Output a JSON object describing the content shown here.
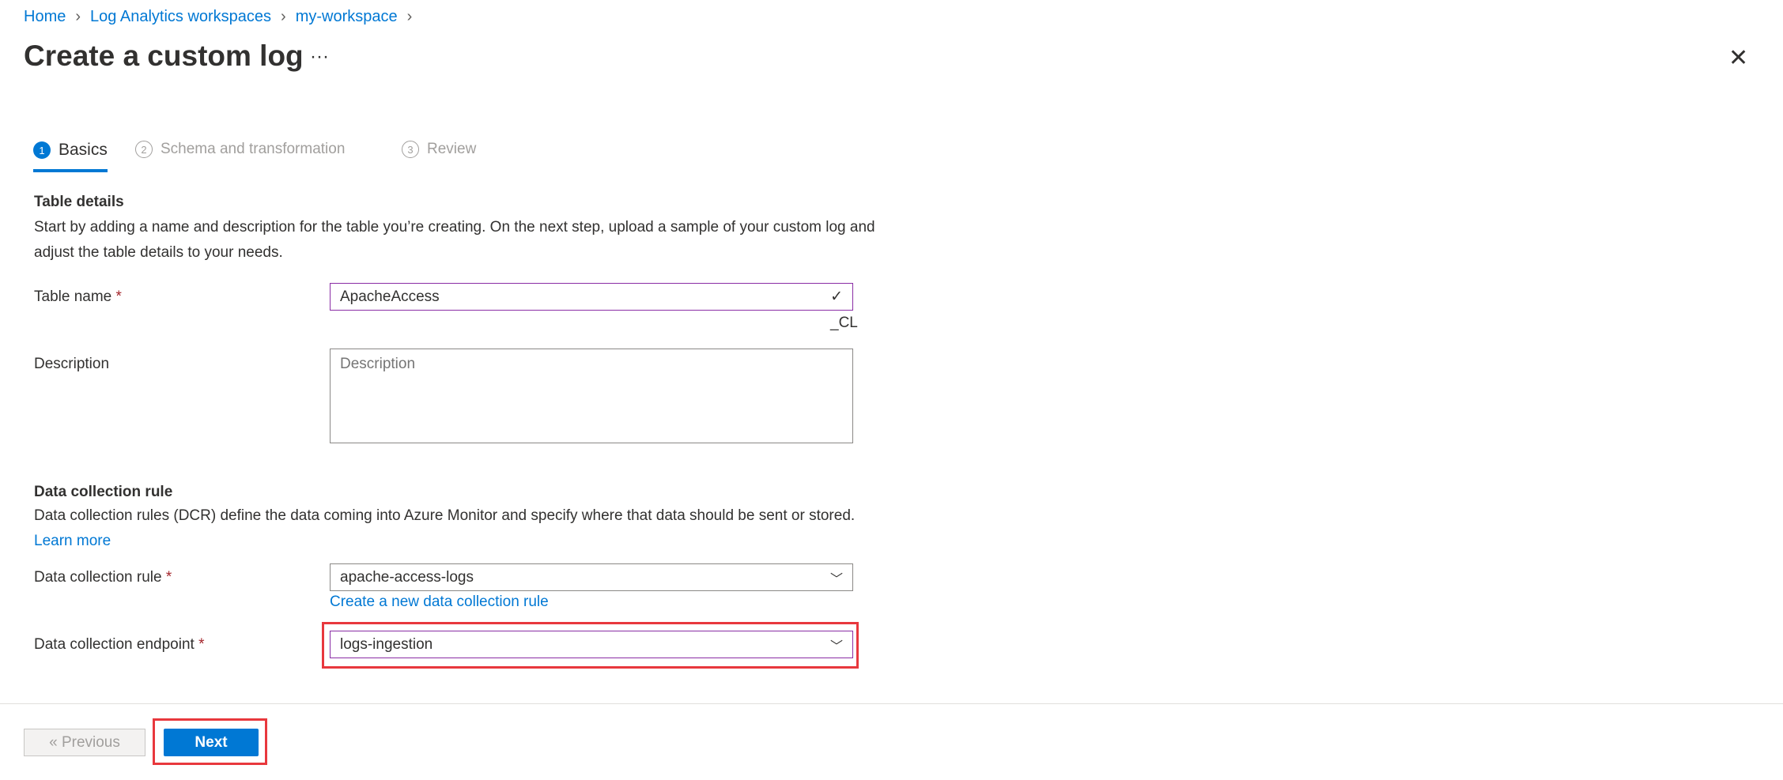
{
  "breadcrumb": [
    "Home",
    "Log Analytics workspaces",
    "my-workspace"
  ],
  "title": "Create a custom log",
  "more": "···",
  "close": "✕",
  "steps": [
    {
      "num": "1",
      "label": "Basics"
    },
    {
      "num": "2",
      "label": "Schema and transformation"
    },
    {
      "num": "3",
      "label": "Review"
    }
  ],
  "table_details": {
    "heading": "Table details",
    "description": "Start by adding a name and description for the table you’re creating. On the next step, upload a sample of your custom log and adjust the table details to your needs.",
    "name_label": "Table name",
    "name_value": "ApacheAccess",
    "suffix": "_CL",
    "desc_label": "Description",
    "desc_placeholder": "Description"
  },
  "dcr": {
    "heading": "Data collection rule",
    "description": "Data collection rules (DCR) define the data coming into Azure Monitor and specify where that data should be sent or stored.",
    "learn_more": "Learn more",
    "rule_label": "Data collection rule",
    "rule_value": "apache-access-logs",
    "create_link": "Create a new data collection rule",
    "endpoint_label": "Data collection endpoint",
    "endpoint_value": "logs-ingestion"
  },
  "required": "*",
  "footer": {
    "previous": "« Previous",
    "next": "Next"
  },
  "colors": {
    "accent": "#0078d4",
    "highlight": "#e8383d",
    "focus": "#8a2da5"
  }
}
